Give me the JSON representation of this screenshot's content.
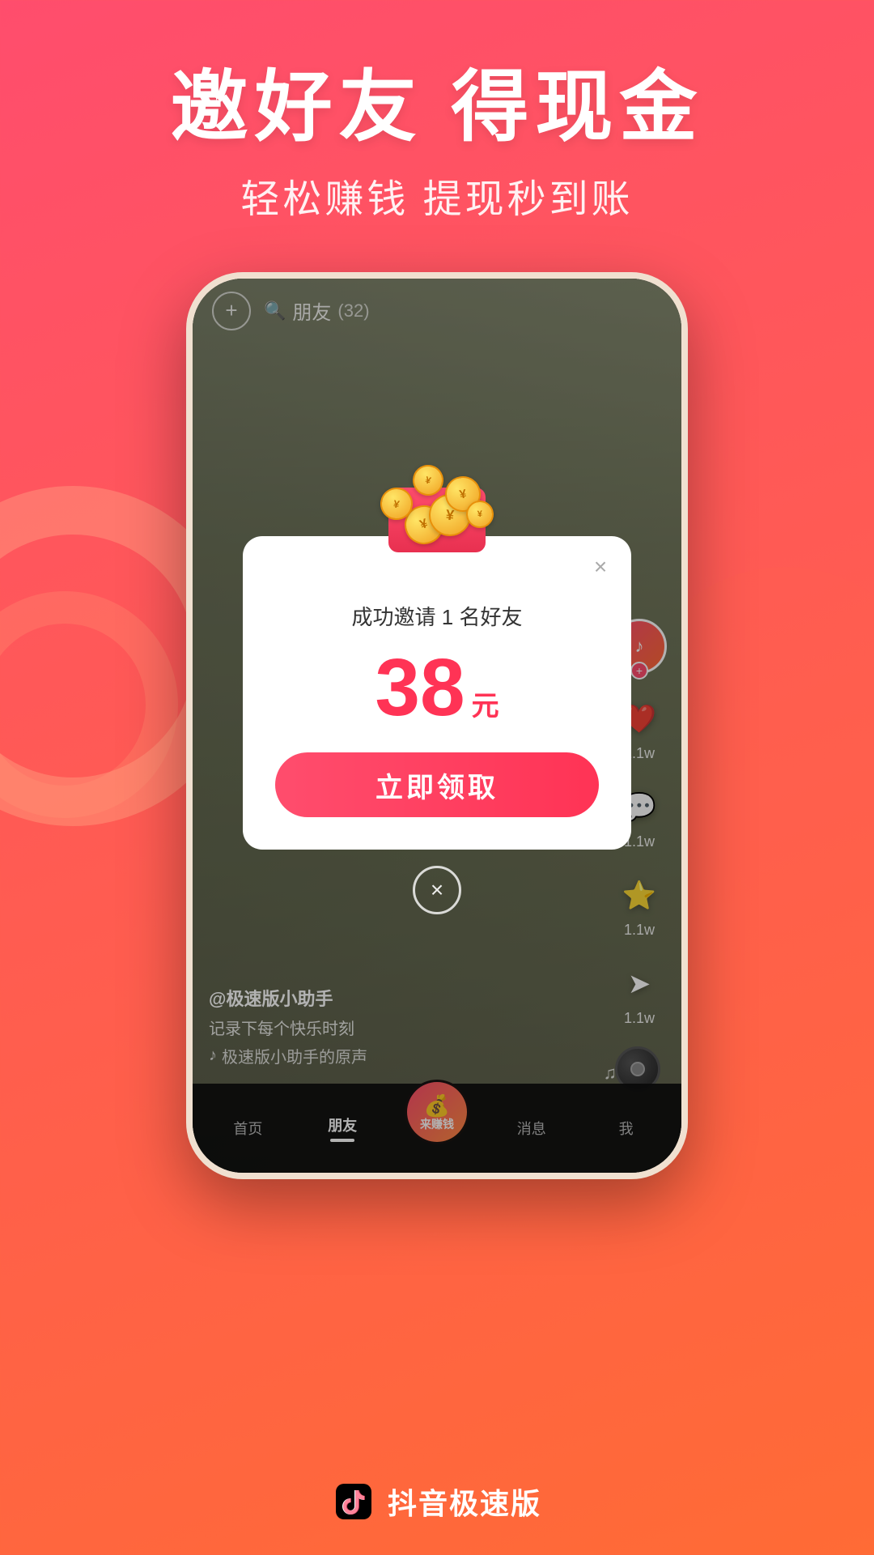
{
  "header": {
    "title": "邀好友 得现金",
    "subtitle": "轻松赚钱 提现秒到账"
  },
  "phone": {
    "topbar": {
      "add_label": "+",
      "search_icon": "search",
      "friends_label": "朋友",
      "friends_count": "(32)"
    },
    "sidebar_icons": {
      "like_count": "1.1w",
      "comment_count": "1.1w",
      "favorite_count": "1.1w",
      "share_count": "1.1w"
    },
    "bottom_info": {
      "username": "@极速版小助手",
      "description": "记录下每个快乐时刻",
      "music": "极速版小助手的原声"
    },
    "nav": {
      "items": [
        {
          "label": "首页",
          "active": false
        },
        {
          "label": "朋友",
          "active": true
        },
        {
          "label": "",
          "active": false,
          "is_center": true
        },
        {
          "label": "消息",
          "active": false
        },
        {
          "label": "我",
          "active": false
        }
      ],
      "center_label": "来赚钱"
    }
  },
  "modal": {
    "close_icon": "×",
    "invite_text": "成功邀请 1 名好友",
    "amount": "38",
    "amount_unit": "元",
    "claim_button_label": "立即领取",
    "dismiss_icon": "×"
  },
  "footer": {
    "app_name": "抖音极速版"
  }
}
